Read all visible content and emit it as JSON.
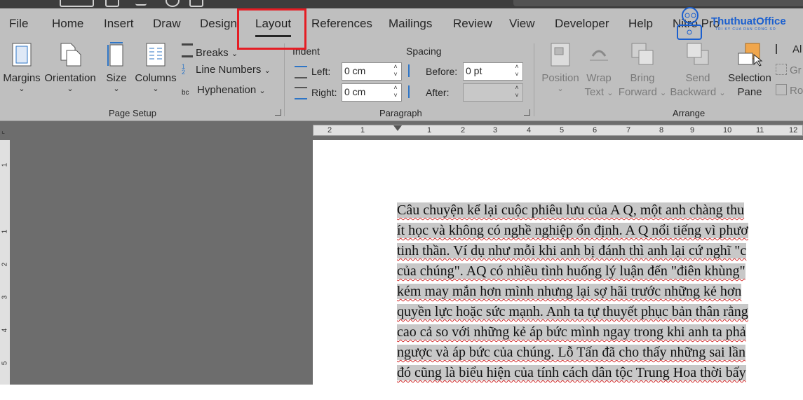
{
  "tabs": [
    {
      "id": "file",
      "label": "File"
    },
    {
      "id": "home",
      "label": "Home"
    },
    {
      "id": "insert",
      "label": "Insert"
    },
    {
      "id": "draw",
      "label": "Draw"
    },
    {
      "id": "design",
      "label": "Design"
    },
    {
      "id": "layout",
      "label": "Layout"
    },
    {
      "id": "references",
      "label": "References"
    },
    {
      "id": "mailings",
      "label": "Mailings"
    },
    {
      "id": "review",
      "label": "Review"
    },
    {
      "id": "view",
      "label": "View"
    },
    {
      "id": "developer",
      "label": "Developer"
    },
    {
      "id": "help",
      "label": "Help"
    },
    {
      "id": "nitro",
      "label": "Nitro Pro"
    }
  ],
  "active_tab": "Layout",
  "page_setup": {
    "margins": "Margins",
    "orientation": "Orientation",
    "size": "Size",
    "columns": "Columns",
    "breaks": "Breaks",
    "line_numbers": "Line Numbers",
    "hyphenation": "Hyphenation",
    "group_label": "Page Setup"
  },
  "paragraph": {
    "indent_heading": "Indent",
    "spacing_heading": "Spacing",
    "left_label": "Left:",
    "left_value": "0 cm",
    "right_label": "Right:",
    "right_value": "0 cm",
    "before_label": "Before:",
    "before_value": "0 pt",
    "after_label": "After:",
    "after_value": "",
    "group_label": "Paragraph"
  },
  "arrange": {
    "position": "Position",
    "wrap_line1": "Wrap",
    "wrap_line2": "Text",
    "bring_line1": "Bring",
    "bring_line2": "Forward",
    "send_line1": "Send",
    "send_line2": "Backward",
    "selection_line1": "Selection",
    "selection_line2": "Pane",
    "align": "Al",
    "group": "Gr",
    "rotate": "Ro",
    "group_label": "Arrange"
  },
  "logo": {
    "brand": "ThuthuatOffice",
    "tagline": "TRI KY CUA DAN CONG SO"
  },
  "ruler": {
    "horizontal": [
      "2",
      "1",
      "1",
      "2",
      "3",
      "4",
      "5",
      "6",
      "7",
      "8",
      "9",
      "10",
      "11",
      "12"
    ],
    "vertical": [
      "1",
      "1",
      "2",
      "3",
      "4",
      "5"
    ]
  },
  "document": {
    "lines": [
      "Câu chuyện kể lại cuộc phiêu lưu của A Q, một anh chàng thu",
      "ít học và không có nghề nghiệp ổn định. A Q nổi tiếng vì phươ",
      "tinh thần. Ví dụ như mỗi khi anh bị đánh thì anh lại cứ nghĩ \"c",
      "của chúng\". AQ có nhiều tình huống lý luận đến \"điên khùng\"",
      "kém may mắn hơn mình nhưng lại sợ hãi trước những kẻ hơn",
      "quyền lực hoặc sức mạnh. Anh ta tự thuyết phục bản thân rằng",
      "cao cả so với những kẻ áp bức mình ngay trong khi anh ta phả",
      "ngược và áp bức của chúng. Lỗ Tấn đã cho thấy những sai lần",
      "đó cũng là biểu hiện của tính cách dân tộc Trung Hoa thời bấy"
    ]
  },
  "colors": {
    "ribbon_bg": "#bfbfbf",
    "highlight": "#e51d24",
    "brand": "#1a5fcf",
    "selection": "#c8c8c8"
  }
}
